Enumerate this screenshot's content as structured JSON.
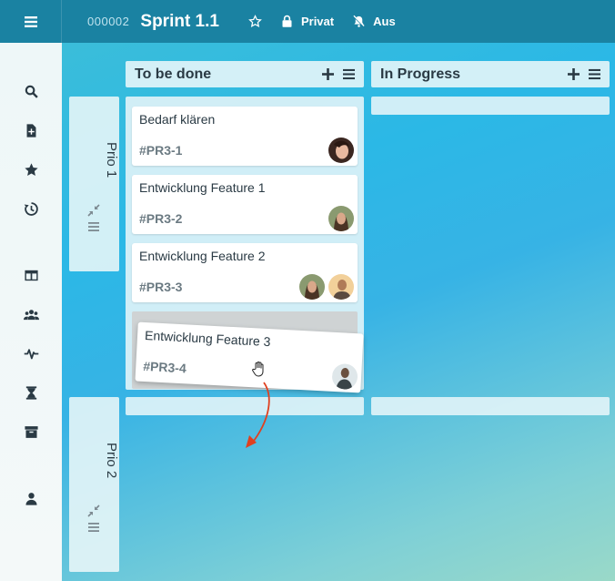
{
  "header": {
    "sprint_id": "000002",
    "sprint_title": "Sprint 1.1",
    "privacy_label": "Privat",
    "notifications_label": "Aus"
  },
  "columns": [
    {
      "title": "To be done"
    },
    {
      "title": "In Progress"
    }
  ],
  "swimlanes": [
    {
      "label": "Prio 1"
    },
    {
      "label": "Prio 2"
    }
  ],
  "cards": [
    {
      "title": "Bedarf klären",
      "id": "#PR3-1"
    },
    {
      "title": "Entwicklung Feature 1",
      "id": "#PR3-2"
    },
    {
      "title": "Entwicklung Feature 2",
      "id": "#PR3-3"
    }
  ],
  "dragging_card": {
    "title": "Entwicklung Feature 3",
    "id": "#PR3-4"
  },
  "colors": {
    "topbar": "#1a82a2",
    "accent_arrow": "#e0401f"
  }
}
